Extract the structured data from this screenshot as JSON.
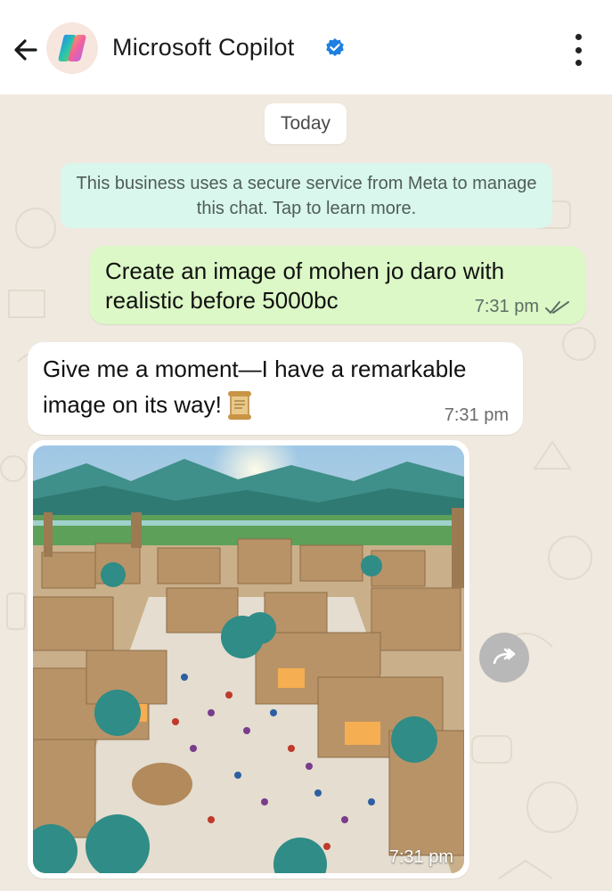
{
  "header": {
    "title": "Microsoft Copilot",
    "verified": true
  },
  "chat": {
    "date_chip": "Today",
    "system_notice": "This business uses a secure service from Meta to manage this chat. Tap to learn more.",
    "messages": [
      {
        "direction": "outgoing",
        "text": "Create an image of mohen jo daro with realistic before 5000bc",
        "time": "7:31 pm",
        "status": "read"
      },
      {
        "direction": "incoming",
        "text": "Give me a moment—I have a remarkable image on its way!",
        "emoji": "scroll-emoji",
        "time": "7:31 pm"
      },
      {
        "direction": "incoming",
        "type": "image",
        "time": "7:31 pm"
      }
    ]
  },
  "colors": {
    "header_bg": "#ffffff",
    "chat_bg": "#efe9df",
    "outgoing_bubble": "#dbf8c6",
    "incoming_bubble": "#ffffff",
    "system_bubble": "#d9f7ec",
    "verified_blue": "#1d7fe0"
  }
}
